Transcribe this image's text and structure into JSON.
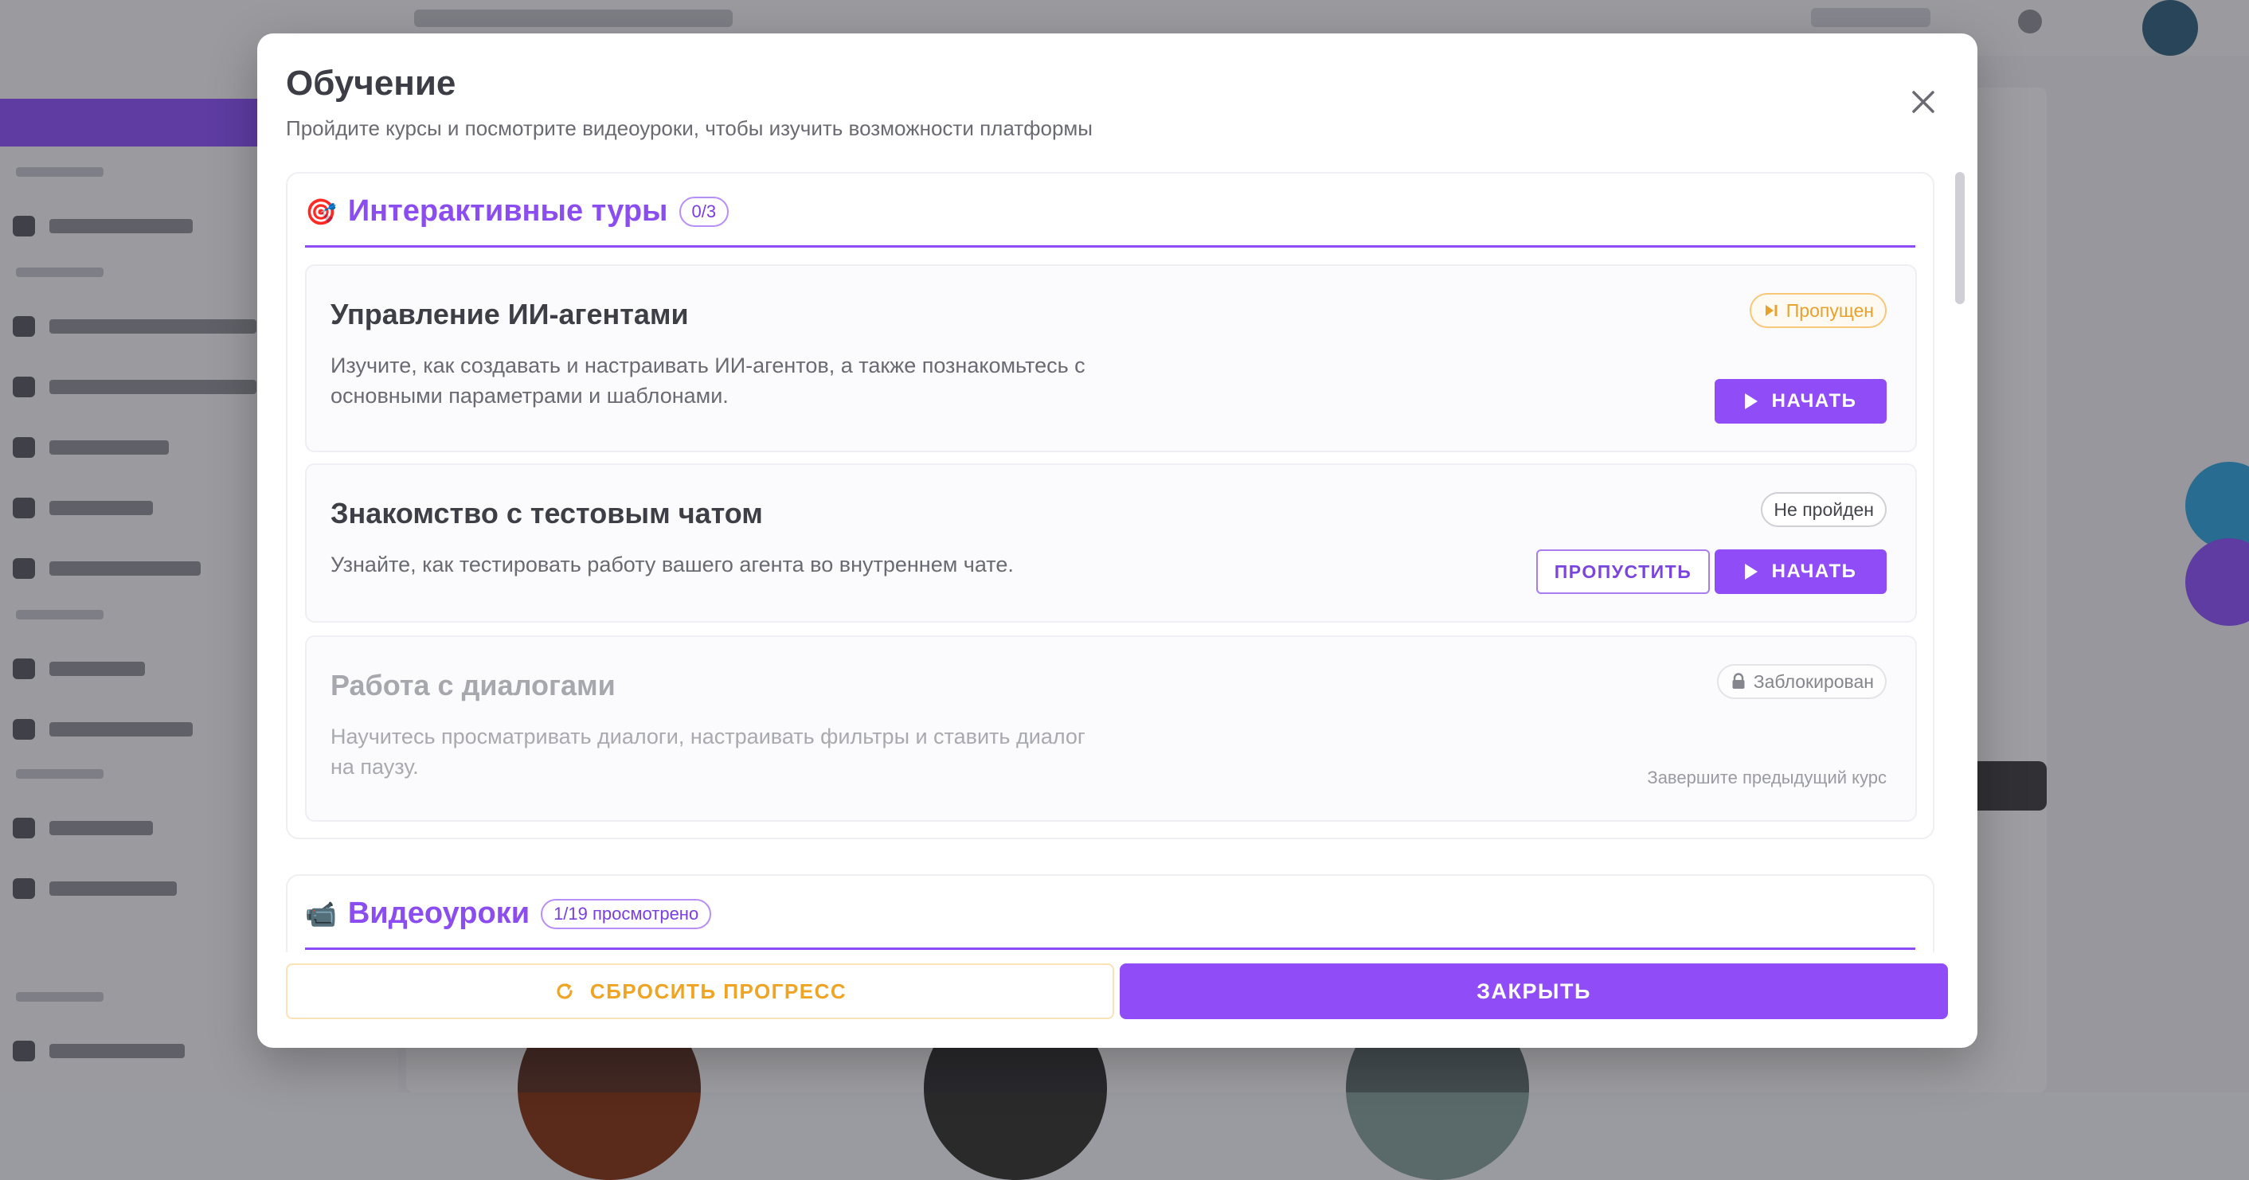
{
  "modal": {
    "title": "Обучение",
    "subtitle": "Пройдите курсы и посмотрите видеоуроки, чтобы изучить возможности платформы",
    "close_icon": "close-icon"
  },
  "tours": {
    "emoji": "🎯",
    "title": "Интерактивные туры",
    "count": "0/3",
    "items": [
      {
        "title": "Управление ИИ-агентами",
        "description": "Изучите, как создавать и настраивать ИИ-агентов, а также познакомьтесь с основными параметрами и шаблонами.",
        "status": "Пропущен",
        "status_icon": "skip-next-icon",
        "start_label": "НАЧАТЬ"
      },
      {
        "title": "Знакомство с тестовым чатом",
        "description": "Узнайте, как тестировать работу вашего агента во внутреннем чате.",
        "status": "Не пройден",
        "skip_label": "ПРОПУСТИТЬ",
        "start_label": "НАЧАТЬ"
      },
      {
        "title": "Работа с диалогами",
        "description": "Научитесь просматривать диалоги, настраивать фильтры и ставить диалог на паузу.",
        "status": "Заблокирован",
        "status_icon": "lock-icon",
        "hint": "Завершите предыдущий курс"
      }
    ]
  },
  "videos": {
    "emoji": "📹",
    "title": "Видеоуроки",
    "count": "1/19 просмотрено"
  },
  "footer": {
    "reset_label": "СБРОСИТЬ ПРОГРЕСС",
    "reset_icon": "refresh-icon",
    "close_label": "ЗАКРЫТЬ"
  },
  "colors": {
    "accent": "#8f4cf7",
    "skipped": "#e7a12c",
    "text": "#3e3e47"
  }
}
